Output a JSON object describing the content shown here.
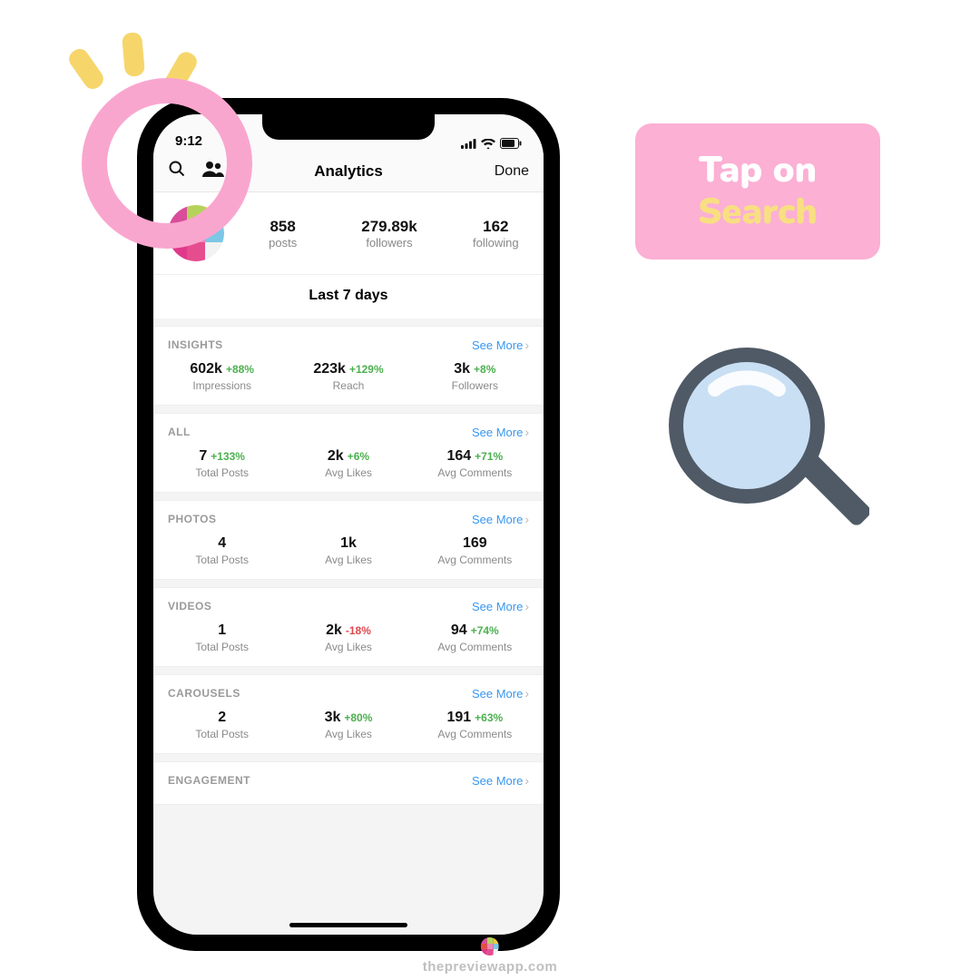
{
  "status": {
    "time": "9:12"
  },
  "nav": {
    "title": "Analytics",
    "done": "Done"
  },
  "profile": {
    "posts": {
      "value": "858",
      "label": "posts"
    },
    "followers": {
      "value": "279.89k",
      "label": "followers"
    },
    "following": {
      "value": "162",
      "label": "following"
    }
  },
  "period": "Last 7 days",
  "see_more": "See More",
  "sections": {
    "insights": {
      "title": "INSIGHTS",
      "m1": {
        "value": "602k",
        "delta": "+88%",
        "label": "Impressions"
      },
      "m2": {
        "value": "223k",
        "delta": "+129%",
        "label": "Reach"
      },
      "m3": {
        "value": "3k",
        "delta": "+8%",
        "label": "Followers"
      }
    },
    "all": {
      "title": "ALL",
      "m1": {
        "value": "7",
        "delta": "+133%",
        "label": "Total Posts"
      },
      "m2": {
        "value": "2k",
        "delta": "+6%",
        "label": "Avg Likes"
      },
      "m3": {
        "value": "164",
        "delta": "+71%",
        "label": "Avg Comments"
      }
    },
    "photos": {
      "title": "PHOTOS",
      "m1": {
        "value": "4",
        "delta": "",
        "label": "Total Posts"
      },
      "m2": {
        "value": "1k",
        "delta": "",
        "label": "Avg Likes"
      },
      "m3": {
        "value": "169",
        "delta": "",
        "label": "Avg Comments"
      }
    },
    "videos": {
      "title": "VIDEOS",
      "m1": {
        "value": "1",
        "delta": "",
        "label": "Total Posts"
      },
      "m2": {
        "value": "2k",
        "delta": "-18%",
        "label": "Avg Likes"
      },
      "m3": {
        "value": "94",
        "delta": "+74%",
        "label": "Avg Comments"
      }
    },
    "carousels": {
      "title": "CAROUSELS",
      "m1": {
        "value": "2",
        "delta": "",
        "label": "Total Posts"
      },
      "m2": {
        "value": "3k",
        "delta": "+80%",
        "label": "Avg Likes"
      },
      "m3": {
        "value": "191",
        "delta": "+63%",
        "label": "Avg Comments"
      }
    },
    "engagement": {
      "title": "ENGAGEMENT"
    }
  },
  "callout": {
    "line1": "Tap on",
    "line2": "Search"
  },
  "footer": "thepreviewapp.com"
}
